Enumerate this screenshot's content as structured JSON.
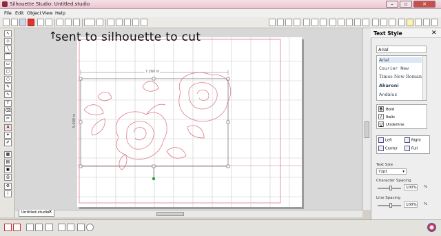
{
  "app": {
    "title": "Silhouette Studio: Untitled.studio"
  },
  "menu": [
    "File",
    "Edit",
    "Object",
    "View",
    "Help"
  ],
  "annotation": "sent to silhouette to cut",
  "canvas": {
    "width_label": "7.260 in",
    "height_label": "5.000 in"
  },
  "document_tab": {
    "label": "Untitled.studio",
    "close": "✕"
  },
  "panel": {
    "title": "Text Style",
    "close": "✕",
    "font_value": "Arial",
    "fonts": [
      "Arial",
      "Courier New",
      "Times New Roman",
      "Aharoni",
      "Andalus"
    ],
    "styles": {
      "bold": "Bold",
      "italic": "Italic",
      "underline": "Underline"
    },
    "align": {
      "left": "Left",
      "right": "Right",
      "center": "Center",
      "full": "Full"
    },
    "text_size_label": "Text Size",
    "text_size_value": "72pt",
    "char_spacing_label": "Character Spacing",
    "char_spacing_value": "100%",
    "line_spacing_label": "Line Spacing",
    "line_spacing_value": "100%",
    "percent": "%"
  },
  "colors": {
    "grid": "#c9c9c9",
    "cut": "#e07a8a",
    "titlebar": "#ecd0d8"
  }
}
